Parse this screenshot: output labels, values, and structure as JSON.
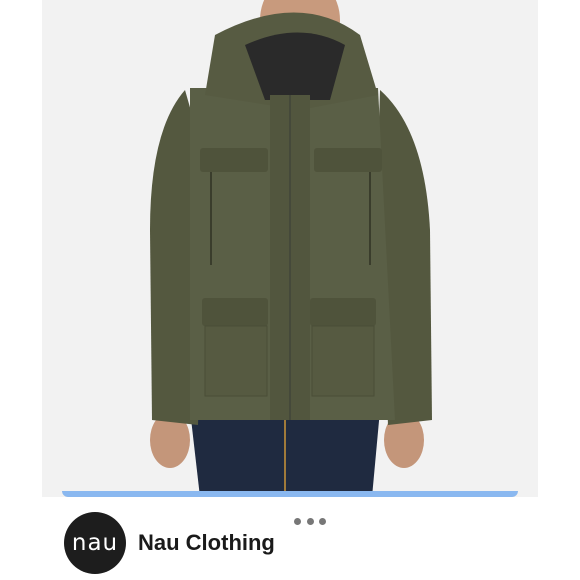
{
  "post": {
    "photo_icon": "product-photo-olive-hooded-jacket",
    "carousel_progress": 1.0,
    "accent_color": "#8ab8f0"
  },
  "account": {
    "avatar_text": "nau",
    "name": "Nau Clothing",
    "avatar_bg": "#1d1d1d"
  },
  "menu": {
    "icon": "more-horizontal-icon"
  }
}
